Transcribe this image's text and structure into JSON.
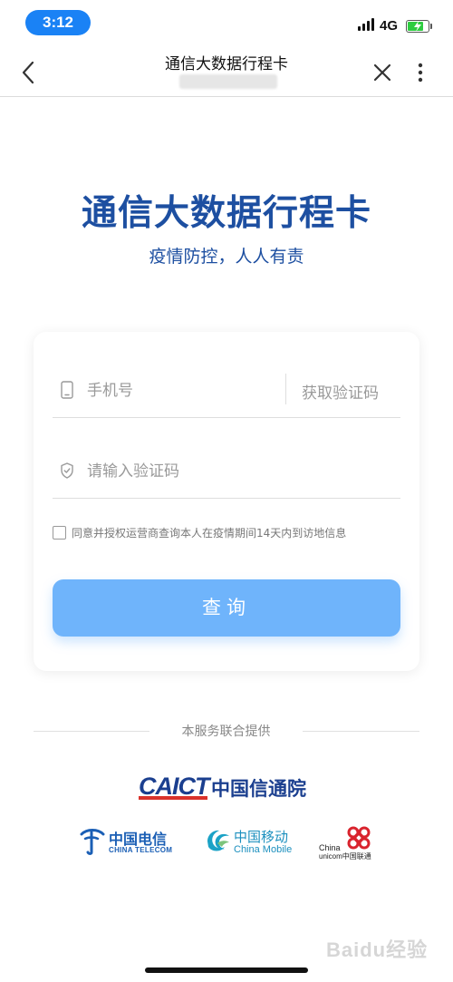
{
  "status_bar": {
    "time": "3:12",
    "network": "4G",
    "battery_level": 0.8,
    "colors": {
      "time_pill": "#1a82f5",
      "battery_fill": "#2ecc40"
    }
  },
  "nav": {
    "title": "通信大数据行程卡",
    "back_icon": "chevron-left-icon",
    "close_icon": "close-icon",
    "more_icon": "more-vertical-icon"
  },
  "hero": {
    "headline": "通信大数据行程卡",
    "subline": "疫情防控，人人有责",
    "color": "#1d4fa1"
  },
  "form": {
    "phone_placeholder": "手机号",
    "get_code_label": "获取验证码",
    "code_placeholder": "请输入验证码",
    "agreement_text": "同意并授权运营商查询本人在疫情期间14天内到访地信息",
    "agreement_checked": false,
    "submit_label": "查询",
    "submit_color": "#6fb4fb"
  },
  "footer": {
    "provider_label": "本服务联合提供",
    "caict": {
      "en": "CAICT",
      "cn": "中国信通院"
    },
    "carriers": [
      {
        "cn": "中国电信",
        "en": "CHINA TELECOM"
      },
      {
        "cn": "中国移动",
        "en": "China Mobile"
      },
      {
        "cn": "中国联通",
        "en_top": "China",
        "en_bottom": "unicom中国联通"
      }
    ]
  },
  "watermark": "Baidu经验"
}
